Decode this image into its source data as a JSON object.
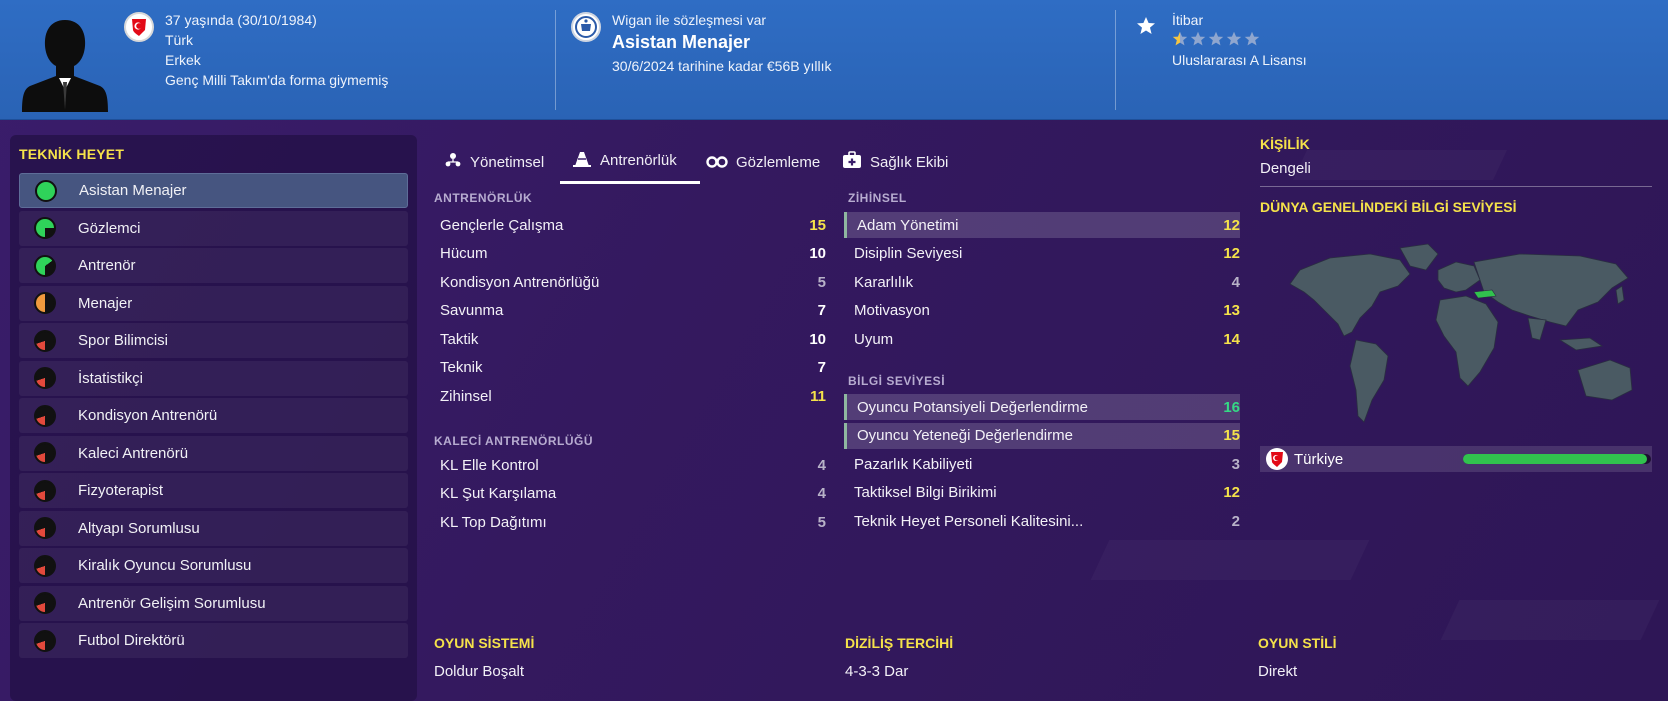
{
  "header": {
    "age_line": "37 yaşında (30/10/1984)",
    "nationality": "Türk",
    "gender": "Erkek",
    "caps_note": "Genç Milli Takım'da forma giymemiş",
    "contract_note": "Wigan ile sözleşmesi var",
    "role": "Asistan Menajer",
    "contract_terms": "30/6/2024 tarihine kadar €56B yıllık",
    "reputation_label": "İtibar",
    "reputation_stars": 0.5,
    "reputation_max": 5,
    "license": "Uluslararası A Lisansı"
  },
  "staff": {
    "title": "TEKNİK HEYET",
    "items": [
      {
        "label": "Asistan Menajer",
        "fill": 1.0,
        "color": "#2fd35a",
        "selected": true
      },
      {
        "label": "Gözlemci",
        "fill": 0.75,
        "color": "#2fd35a"
      },
      {
        "label": "Antrenör",
        "fill": 0.65,
        "color": "#2fd35a"
      },
      {
        "label": "Menajer",
        "fill": 0.5,
        "color": "#f09a3e"
      },
      {
        "label": "Spor Bilimcisi",
        "fill": 0.2,
        "color": "#e2493c"
      },
      {
        "label": "İstatistikçi",
        "fill": 0.2,
        "color": "#e2493c"
      },
      {
        "label": "Kondisyon Antrenörü",
        "fill": 0.2,
        "color": "#e2493c"
      },
      {
        "label": "Kaleci Antrenörü",
        "fill": 0.2,
        "color": "#e2493c"
      },
      {
        "label": "Fizyoterapist",
        "fill": 0.2,
        "color": "#e2493c"
      },
      {
        "label": "Altyapı Sorumlusu",
        "fill": 0.2,
        "color": "#e2493c"
      },
      {
        "label": "Kiralık Oyuncu Sorumlusu",
        "fill": 0.2,
        "color": "#e2493c"
      },
      {
        "label": "Antrenör Gelişim Sorumlusu",
        "fill": 0.2,
        "color": "#e2493c"
      },
      {
        "label": "Futbol Direktörü",
        "fill": 0.2,
        "color": "#e2493c"
      }
    ]
  },
  "tabs": [
    {
      "label": "Yönetimsel",
      "icon": "management-icon"
    },
    {
      "label": "Antrenörlük",
      "icon": "coaching-cone-icon",
      "active": true
    },
    {
      "label": "Gözlemleme",
      "icon": "binoculars-icon"
    },
    {
      "label": "Sağlık Ekibi",
      "icon": "medical-kit-icon"
    }
  ],
  "coaching": {
    "title": "ANTRENÖRLÜK",
    "rows": [
      {
        "label": "Gençlerle Çalışma",
        "value": "15"
      },
      {
        "label": "Hücum",
        "value": "10"
      },
      {
        "label": "Kondisyon Antrenörlüğü",
        "value": "5"
      },
      {
        "label": "Savunma",
        "value": "7"
      },
      {
        "label": "Taktik",
        "value": "10"
      },
      {
        "label": "Teknik",
        "value": "7"
      },
      {
        "label": "Zihinsel",
        "value": "11"
      }
    ]
  },
  "gk_coaching": {
    "title": "KALECİ ANTRENÖRLÜĞÜ",
    "rows": [
      {
        "label": "KL Elle Kontrol",
        "value": "4"
      },
      {
        "label": "KL Şut Karşılama",
        "value": "4"
      },
      {
        "label": "KL Top Dağıtımı",
        "value": "5"
      }
    ]
  },
  "mental": {
    "title": "ZİHİNSEL",
    "rows": [
      {
        "label": "Adam Yönetimi",
        "value": "12",
        "highlight": true
      },
      {
        "label": "Disiplin Seviyesi",
        "value": "12"
      },
      {
        "label": "Kararlılık",
        "value": "4"
      },
      {
        "label": "Motivasyon",
        "value": "13"
      },
      {
        "label": "Uyum",
        "value": "14"
      }
    ]
  },
  "knowledge": {
    "title": "BİLGİ SEVİYESİ",
    "rows": [
      {
        "label": "Oyuncu Potansiyeli Değerlendirme",
        "value": "16",
        "highlight": true
      },
      {
        "label": "Oyuncu Yeteneği Değerlendirme",
        "value": "15",
        "highlight": true
      },
      {
        "label": "Pazarlık Kabiliyeti",
        "value": "3"
      },
      {
        "label": "Taktiksel Bilgi Birikimi",
        "value": "12"
      },
      {
        "label": "Teknik Heyet Personeli Kalitesini...",
        "value": "2"
      }
    ]
  },
  "personality": {
    "title": "KİŞİLİK",
    "value": "Dengeli"
  },
  "world_knowledge": {
    "title": "DÜNYA GENELİNDEKİ BİLGİ SEVİYESİ",
    "country": "Türkiye",
    "level": 0.98
  },
  "bottom": {
    "system_title": "OYUN SİSTEMİ",
    "system_value": "Doldur Boşalt",
    "formation_title": "DİZİLİŞ TERCİHİ",
    "formation_value": "4-3-3 Dar",
    "style_title": "OYUN STİLİ",
    "style_value": "Direkt"
  },
  "colors": {
    "value_high": "#f5e24a",
    "value_top": "#35d985",
    "value_mid": "#ffffff",
    "value_low": "#b8b2c8"
  }
}
